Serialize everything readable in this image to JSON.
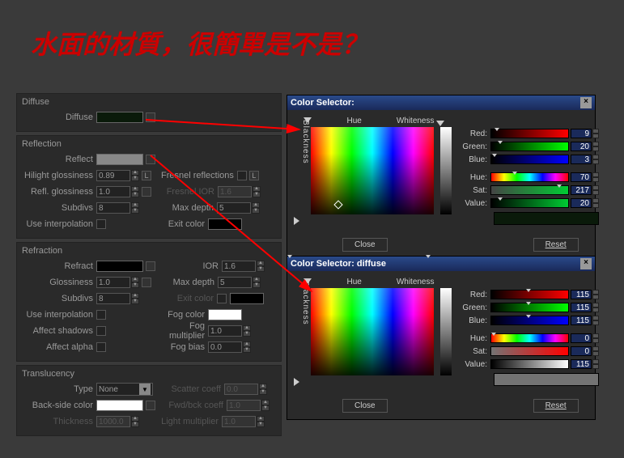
{
  "title": "水面的材質，很簡單是不是？",
  "groups": {
    "diffuse": {
      "title": "Diffuse",
      "diffuse_label": "Diffuse"
    },
    "reflection": {
      "title": "Reflection",
      "reflect_label": "Reflect",
      "hilight_gloss_label": "Hilight glossiness",
      "hilight_gloss_val": "0.89",
      "lock_label": "L",
      "fresnel_label": "Fresnel reflections",
      "fresnel_lock": "L",
      "refl_gloss_label": "Refl. glossiness",
      "refl_gloss_val": "1.0",
      "fresnel_ior_label": "Fresnel IOR",
      "fresnel_ior_val": "1.6",
      "subdivs_label": "Subdivs",
      "subdivs_val": "8",
      "max_depth_label": "Max depth",
      "max_depth_val": "5",
      "use_interp_label": "Use interpolation",
      "exit_color_label": "Exit color"
    },
    "refraction": {
      "title": "Refraction",
      "refract_label": "Refract",
      "ior_label": "IOR",
      "ior_val": "1.6",
      "gloss_label": "Glossiness",
      "gloss_val": "1.0",
      "max_depth_label": "Max depth",
      "max_depth_val": "5",
      "subdivs_label": "Subdivs",
      "subdivs_val": "8",
      "exit_color_label": "Exit color",
      "use_interp_label": "Use interpolation",
      "fog_color_label": "Fog color",
      "affect_shadows_label": "Affect shadows",
      "fog_mult_label": "Fog multiplier",
      "fog_mult_val": "1.0",
      "affect_alpha_label": "Affect alpha",
      "fog_bias_label": "Fog bias",
      "fog_bias_val": "0.0"
    },
    "translucency": {
      "title": "Translucency",
      "type_label": "Type",
      "type_val": "None",
      "scatter_label": "Scatter coeff",
      "scatter_val": "0.0",
      "backside_label": "Back-side color",
      "fwdbck_label": "Fwd/bck coeff",
      "fwdbck_val": "1.0",
      "thickness_label": "Thickness",
      "thickness_val": "1000.0",
      "lightmult_label": "Light multiplier",
      "lightmult_val": "1.0"
    }
  },
  "selector1": {
    "title": "Color Selector:",
    "hue": "Hue",
    "whiteness": "Whiteness",
    "blackness": "Blackness",
    "red_label": "Red:",
    "red_val": "9",
    "green_label": "Green:",
    "green_val": "20",
    "blue_label": "Blue:",
    "blue_val": "3",
    "hue_label": "Hue:",
    "hue_val": "70",
    "sat_label": "Sat:",
    "sat_val": "217",
    "value_label": "Value:",
    "value_val": "20",
    "close": "Close",
    "reset": "Reset"
  },
  "selector2": {
    "title": "Color Selector: diffuse",
    "hue": "Hue",
    "whiteness": "Whiteness",
    "blackness": "Blackness",
    "red_label": "Red:",
    "red_val": "115",
    "green_label": "Green:",
    "green_val": "115",
    "blue_label": "Blue:",
    "blue_val": "115",
    "hue_label": "Hue:",
    "hue_val": "0",
    "sat_label": "Sat:",
    "sat_val": "0",
    "value_label": "Value:",
    "value_val": "115",
    "close": "Close",
    "reset": "Reset"
  }
}
